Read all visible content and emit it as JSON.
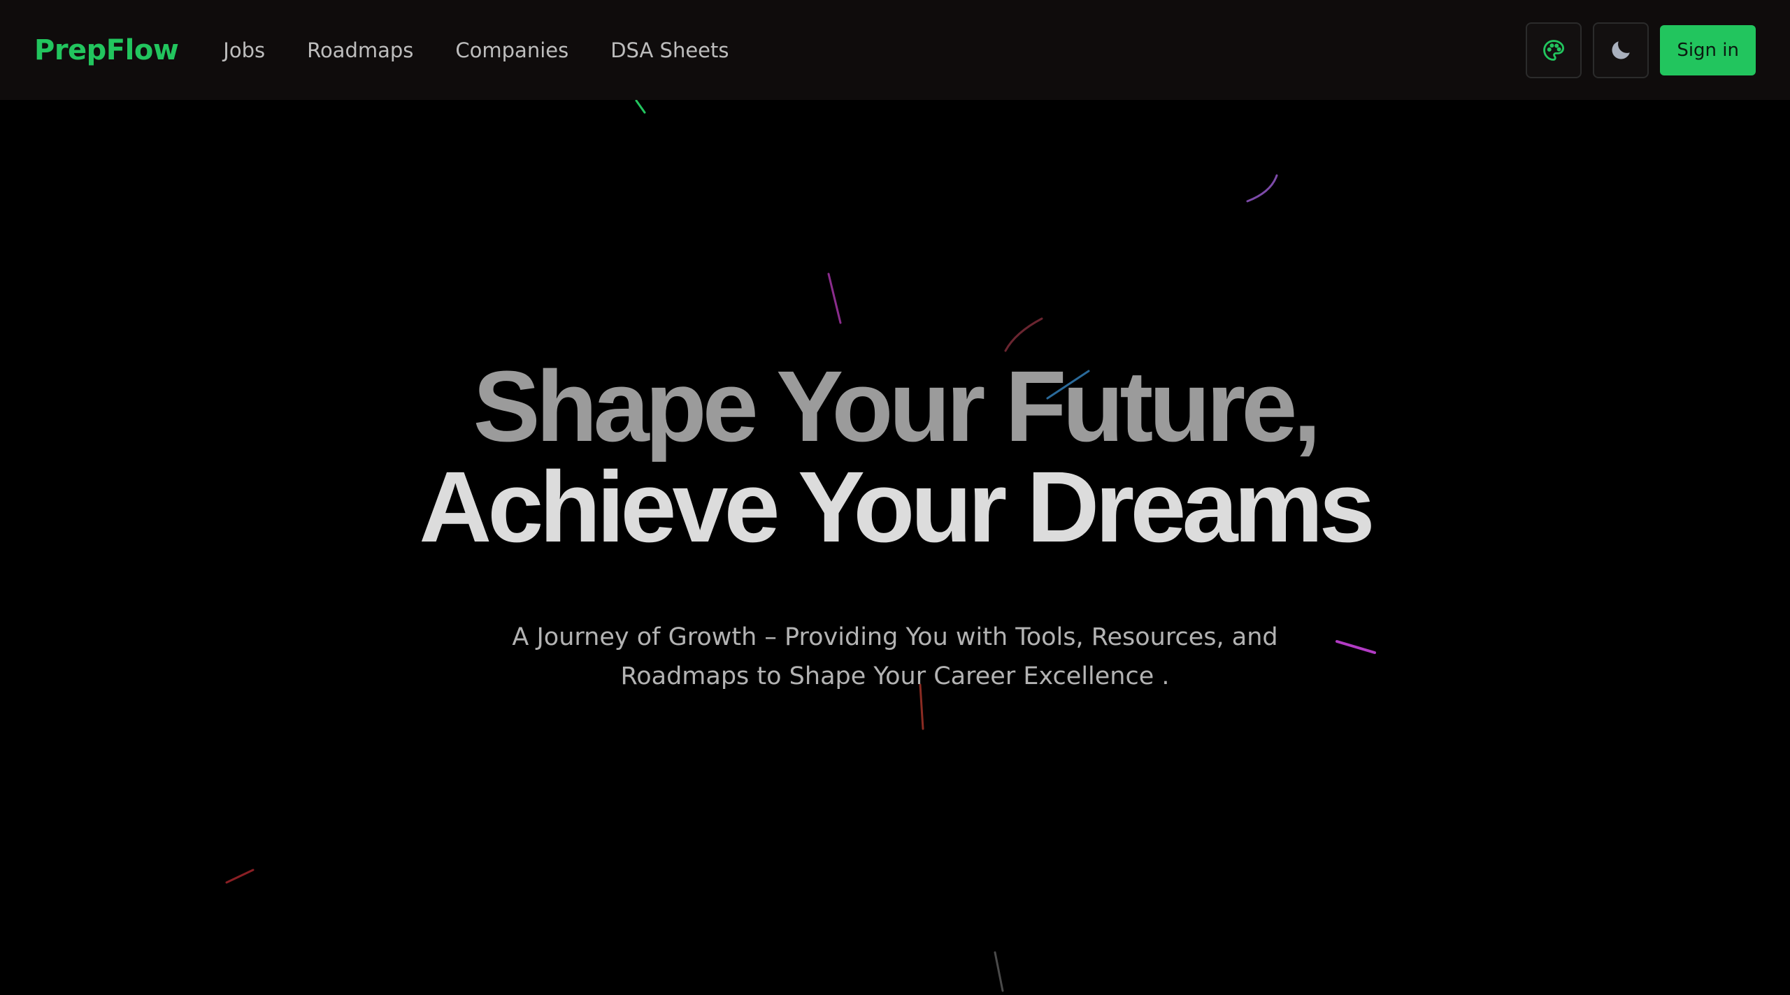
{
  "navbar": {
    "brand": "PrepFlow",
    "links": [
      {
        "label": "Jobs"
      },
      {
        "label": "Roadmaps"
      },
      {
        "label": "Companies"
      },
      {
        "label": "DSA Sheets"
      }
    ],
    "theme_button_icon": "palette-icon",
    "mode_button_icon": "moon-icon",
    "signin_label": "Sign in"
  },
  "hero": {
    "title_line_1": "Shape Your Future,",
    "title_line_2": "Achieve Your Dreams",
    "subtitle": "A Journey of Growth – Providing You with Tools, Resources, and Roadmaps to Shape Your Career Excellence ."
  },
  "colors": {
    "accent": "#22c55e",
    "navbar_bg": "#0f0c0c",
    "page_bg": "#000000",
    "nav_text": "#bdbdbd",
    "title_line_1": "#9b9b9b",
    "title_line_2": "#dcdcdc",
    "subtitle_text": "#b3b3b3"
  }
}
